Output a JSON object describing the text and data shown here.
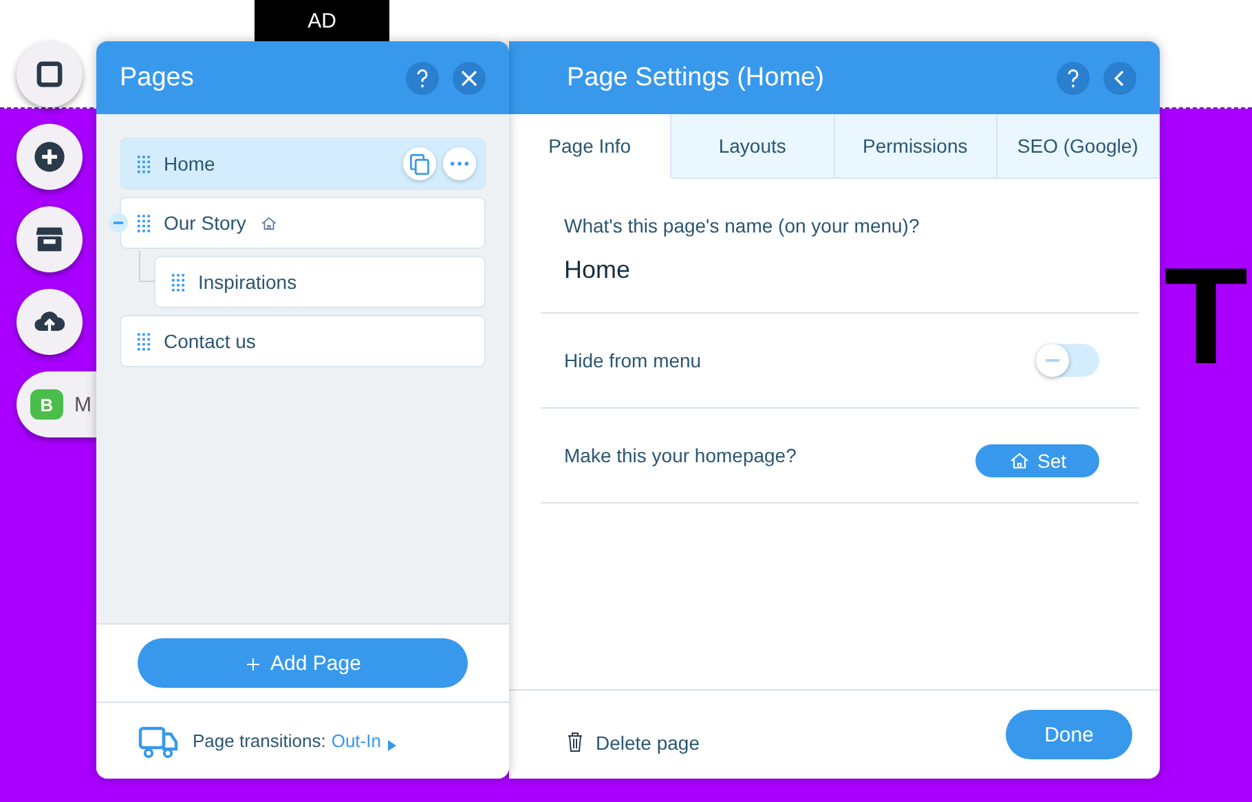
{
  "canvas": {
    "ad_tag": "AD",
    "big_letter": "T",
    "chip": {
      "badge": "B",
      "label": "M"
    }
  },
  "pages_panel": {
    "title": "Pages",
    "pages": [
      {
        "label": "Home",
        "selected": true,
        "is_homepage": false
      },
      {
        "label": "Our Story",
        "selected": false,
        "is_homepage": true,
        "expanded": true,
        "children": [
          {
            "label": "Inspirations",
            "selected": false,
            "is_homepage": false
          }
        ]
      },
      {
        "label": "Contact us",
        "selected": false,
        "is_homepage": false
      }
    ],
    "add_button": "Add Page",
    "transitions": {
      "label": "Page transitions:",
      "value": "Out-In"
    }
  },
  "settings_panel": {
    "title": "Page Settings (Home)",
    "tabs": [
      {
        "label": "Page Info",
        "selected": true
      },
      {
        "label": "Layouts",
        "selected": false
      },
      {
        "label": "Permissions",
        "selected": false
      },
      {
        "label": "SEO (Google)",
        "selected": false
      }
    ],
    "name_label": "What's this page's name (on your menu)?",
    "name_value": "Home",
    "hide_from_menu": {
      "label": "Hide from menu",
      "on": false
    },
    "homepage": {
      "label": "Make this your homepage?",
      "button": "Set"
    },
    "delete": "Delete page",
    "done": "Done"
  }
}
